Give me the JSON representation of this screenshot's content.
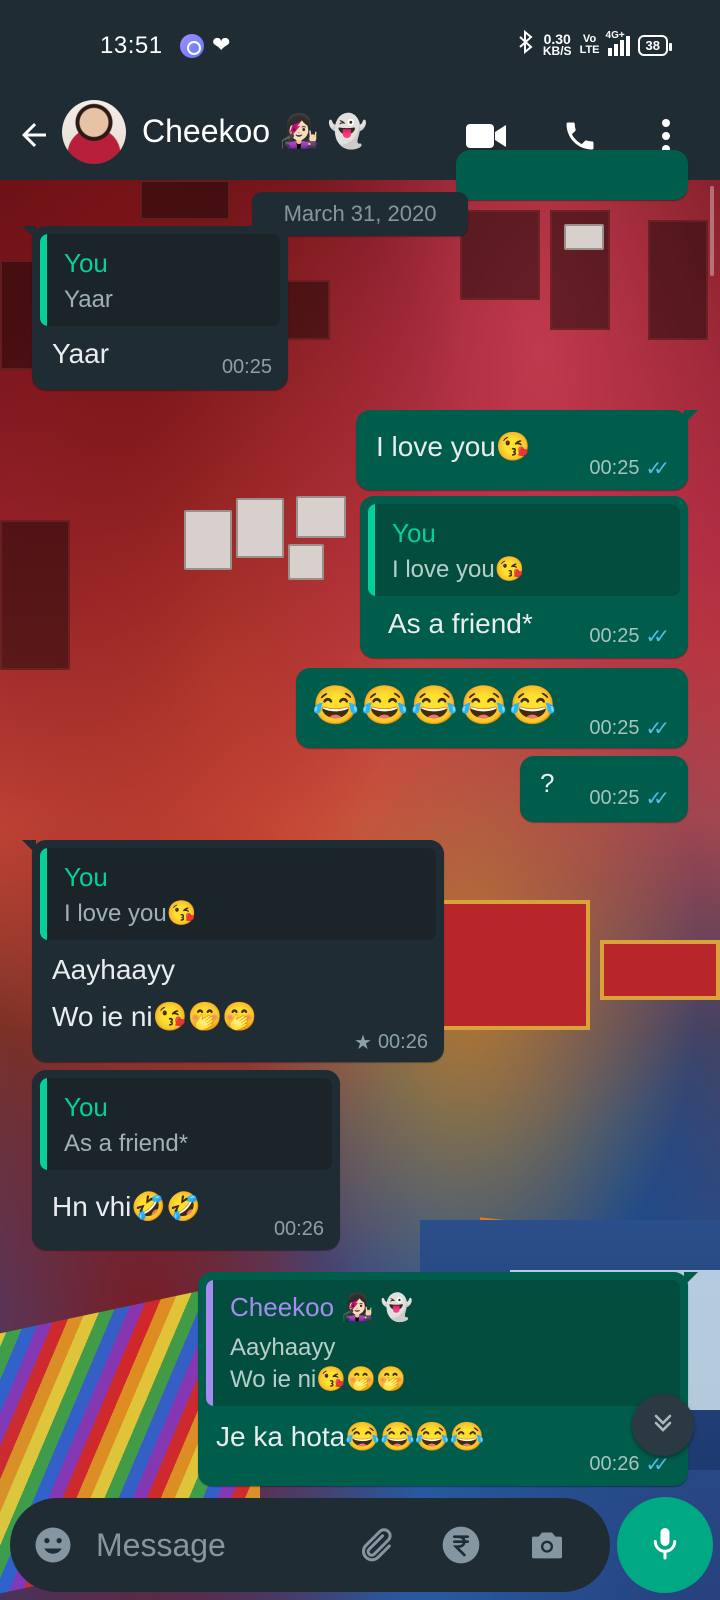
{
  "status_bar": {
    "time": "13:51",
    "speed_value": "0.30",
    "speed_unit": "KB/S",
    "volte_top": "Vo",
    "volte_bottom": "LTE",
    "network": "4G+",
    "battery": "38"
  },
  "header": {
    "contact_name": "Cheekoo 👩🏻‍🎤 👻",
    "icons": [
      "back-arrow-icon",
      "video-call-icon",
      "voice-call-icon",
      "more-options-icon"
    ]
  },
  "date_divider": "March 31, 2020",
  "messages": [
    {
      "id": "m1",
      "direction": "in",
      "quote": {
        "name": "You",
        "text": "Yaar"
      },
      "text": "Yaar",
      "time": "00:25"
    },
    {
      "id": "m2",
      "direction": "out",
      "text": "I love you😘",
      "time": "00:25",
      "status": "read"
    },
    {
      "id": "m3",
      "direction": "out",
      "quote": {
        "name": "You",
        "text": "I love you😘"
      },
      "text": "As a friend*",
      "time": "00:25",
      "status": "read"
    },
    {
      "id": "m4",
      "direction": "out",
      "text": "😂😂😂😂😂",
      "time": "00:25",
      "status": "read"
    },
    {
      "id": "m5",
      "direction": "out",
      "text": "?",
      "time": "00:25",
      "status": "read"
    },
    {
      "id": "m6",
      "direction": "in",
      "quote": {
        "name": "You",
        "text": "I love you😘"
      },
      "text_line1": "Aayhaayy",
      "text_line2": "Wo ie ni😘🤭🤭",
      "time": "00:26",
      "starred": true
    },
    {
      "id": "m7",
      "direction": "in",
      "quote": {
        "name": "You",
        "text": "As a friend*"
      },
      "text": "Hn vhi🤣🤣",
      "time": "00:26"
    },
    {
      "id": "m8",
      "direction": "out",
      "quote": {
        "name": "Cheekoo 👩🏻‍🎤 👻",
        "text_line1": "Aayhaayy",
        "text_line2": "Wo ie ni😘🤭🤭"
      },
      "text": "Je ka hota😂😂😂😂",
      "time": "00:26",
      "status": "read"
    }
  ],
  "composer": {
    "placeholder": "Message",
    "icons": [
      "emoji-icon",
      "attach-icon",
      "rupee-payment-icon",
      "camera-icon",
      "mic-icon"
    ]
  },
  "colors": {
    "header_bg": "#1f2c34",
    "incoming_bubble": "#1f2c34",
    "outgoing_bubble": "#005c4b",
    "accent_green": "#00a884",
    "quote_name_green": "#06cf9c",
    "quote_name_purple": "#a68bf0",
    "read_ticks": "#53bdeb"
  }
}
